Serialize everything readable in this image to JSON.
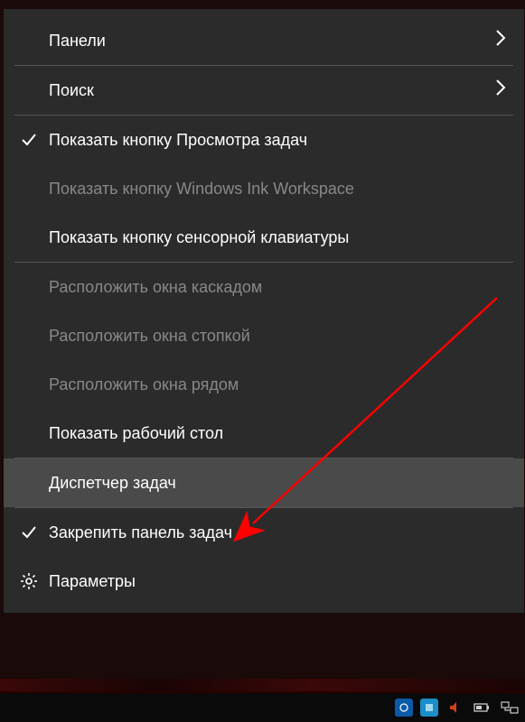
{
  "menu": {
    "panels": {
      "label": "Панели",
      "has_submenu": true
    },
    "search": {
      "label": "Поиск",
      "has_submenu": true
    },
    "taskview": {
      "label": "Показать кнопку Просмотра задач",
      "checked": true
    },
    "ink": {
      "label": "Показать кнопку Windows Ink Workspace",
      "disabled": true
    },
    "touchkbd": {
      "label": "Показать кнопку сенсорной клавиатуры"
    },
    "cascade": {
      "label": "Расположить окна каскадом",
      "disabled": true
    },
    "stacked": {
      "label": "Расположить окна стопкой",
      "disabled": true
    },
    "sidebyside": {
      "label": "Расположить окна рядом",
      "disabled": true
    },
    "desktop": {
      "label": "Показать рабочий стол"
    },
    "taskmgr": {
      "label": "Диспетчер задач",
      "highlighted": true
    },
    "lock": {
      "label": "Закрепить панель задач",
      "checked": true
    },
    "settings": {
      "label": "Параметры",
      "icon": "gear"
    }
  }
}
